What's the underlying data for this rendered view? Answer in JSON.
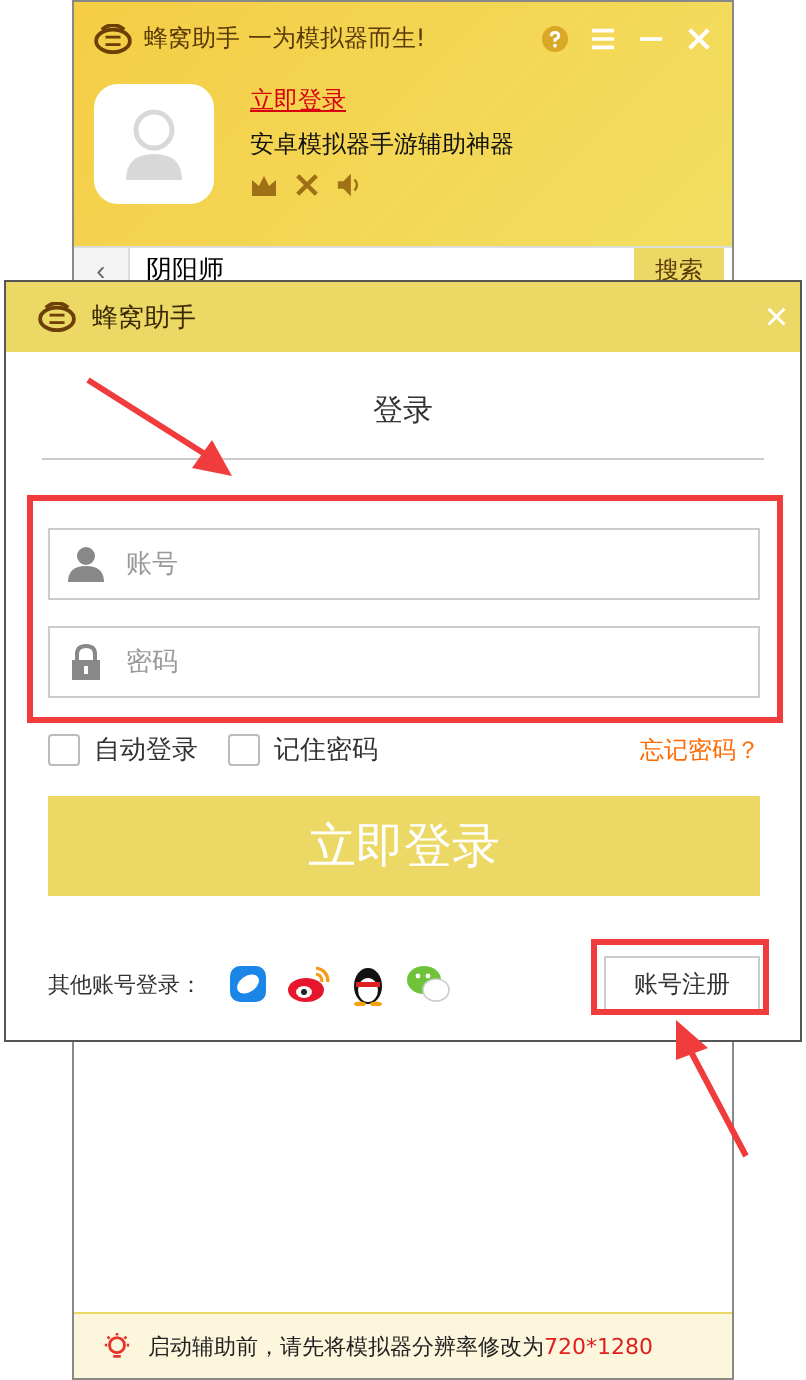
{
  "main_window": {
    "title": "蜂窝助手 一为模拟器而生!",
    "login_link": "立即登录",
    "subtitle": "安卓模拟器手游辅助神器",
    "search": {
      "back": "‹",
      "value": "阴阳师",
      "button": "搜索"
    },
    "tip": {
      "text": "启动辅助前，请先将模拟器分辨率修改为",
      "highlight": "720*1280"
    }
  },
  "login_dialog": {
    "title": "蜂窝助手",
    "close": "×",
    "heading": "登录",
    "fields": [
      {
        "kind": "account",
        "placeholder": "账号"
      },
      {
        "kind": "password",
        "placeholder": "密码"
      }
    ],
    "options": [
      {
        "label": "自动登录",
        "checked": false
      },
      {
        "label": "记住密码",
        "checked": false
      }
    ],
    "forgot": "忘记密码？",
    "login_button": "立即登录",
    "other_label": "其他账号登录：",
    "register_button": "账号注册"
  }
}
